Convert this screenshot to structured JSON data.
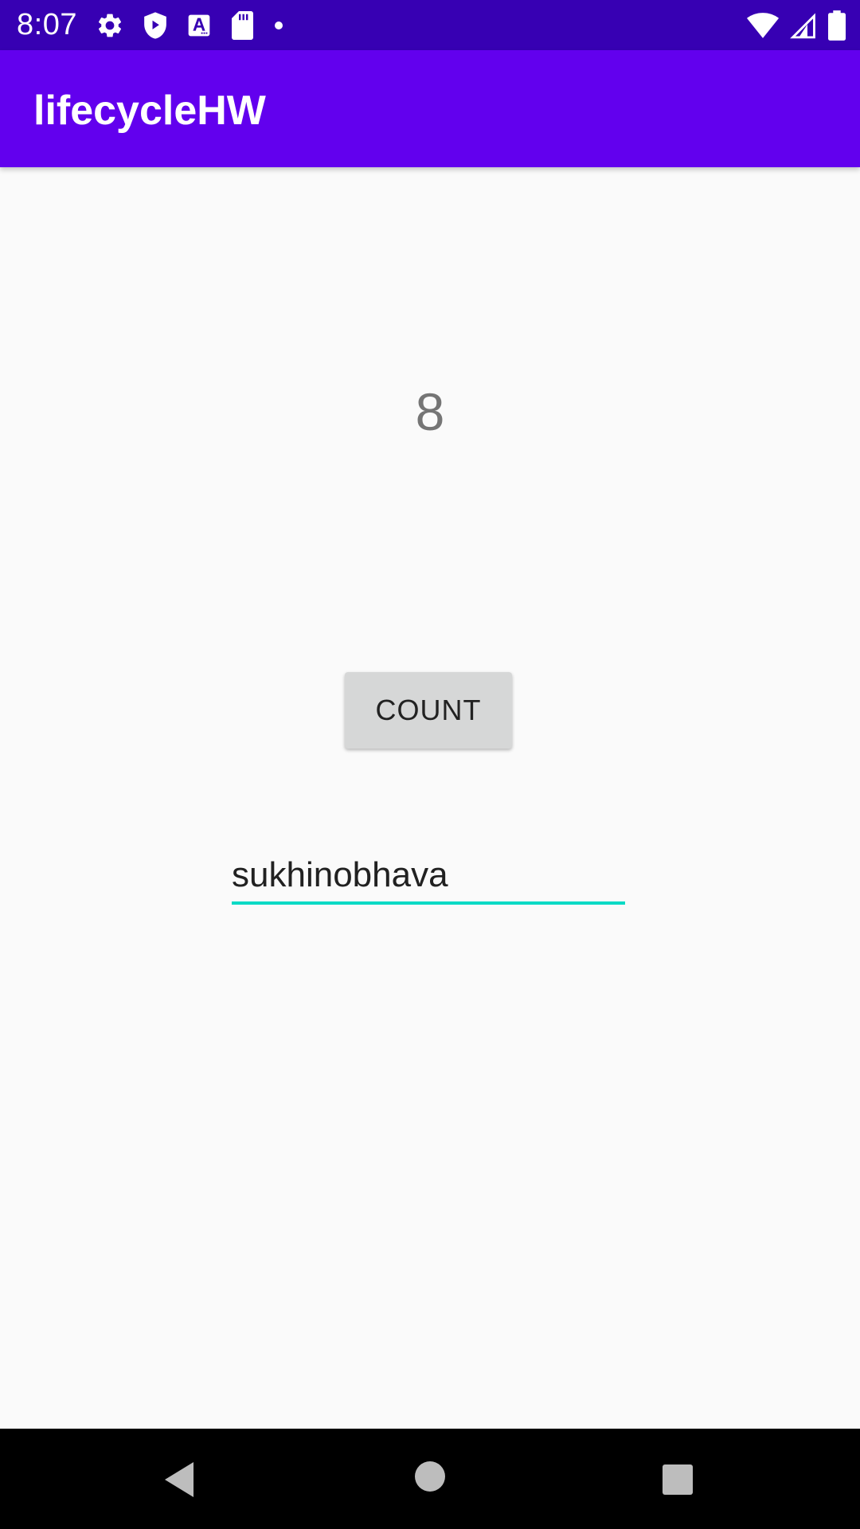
{
  "status_bar": {
    "time": "8:07",
    "left_icons": [
      "gear-icon",
      "shield-play-icon",
      "text-a-icon",
      "sd-card-icon",
      "dot-icon"
    ],
    "right_icons": [
      "wifi-icon",
      "cell-signal-icon",
      "battery-icon"
    ]
  },
  "app_bar": {
    "title": "lifecycleHW"
  },
  "main": {
    "counter_value": "8",
    "count_button_label": "COUNT",
    "text_input_value": "sukhinobhava"
  },
  "navigation_bar": {
    "icons": [
      "back-icon",
      "home-icon",
      "recents-icon"
    ]
  },
  "colors": {
    "status_bar": "#3700b3",
    "app_bar": "#6200ee",
    "accent": "#03dac5",
    "background": "#fafafa"
  }
}
